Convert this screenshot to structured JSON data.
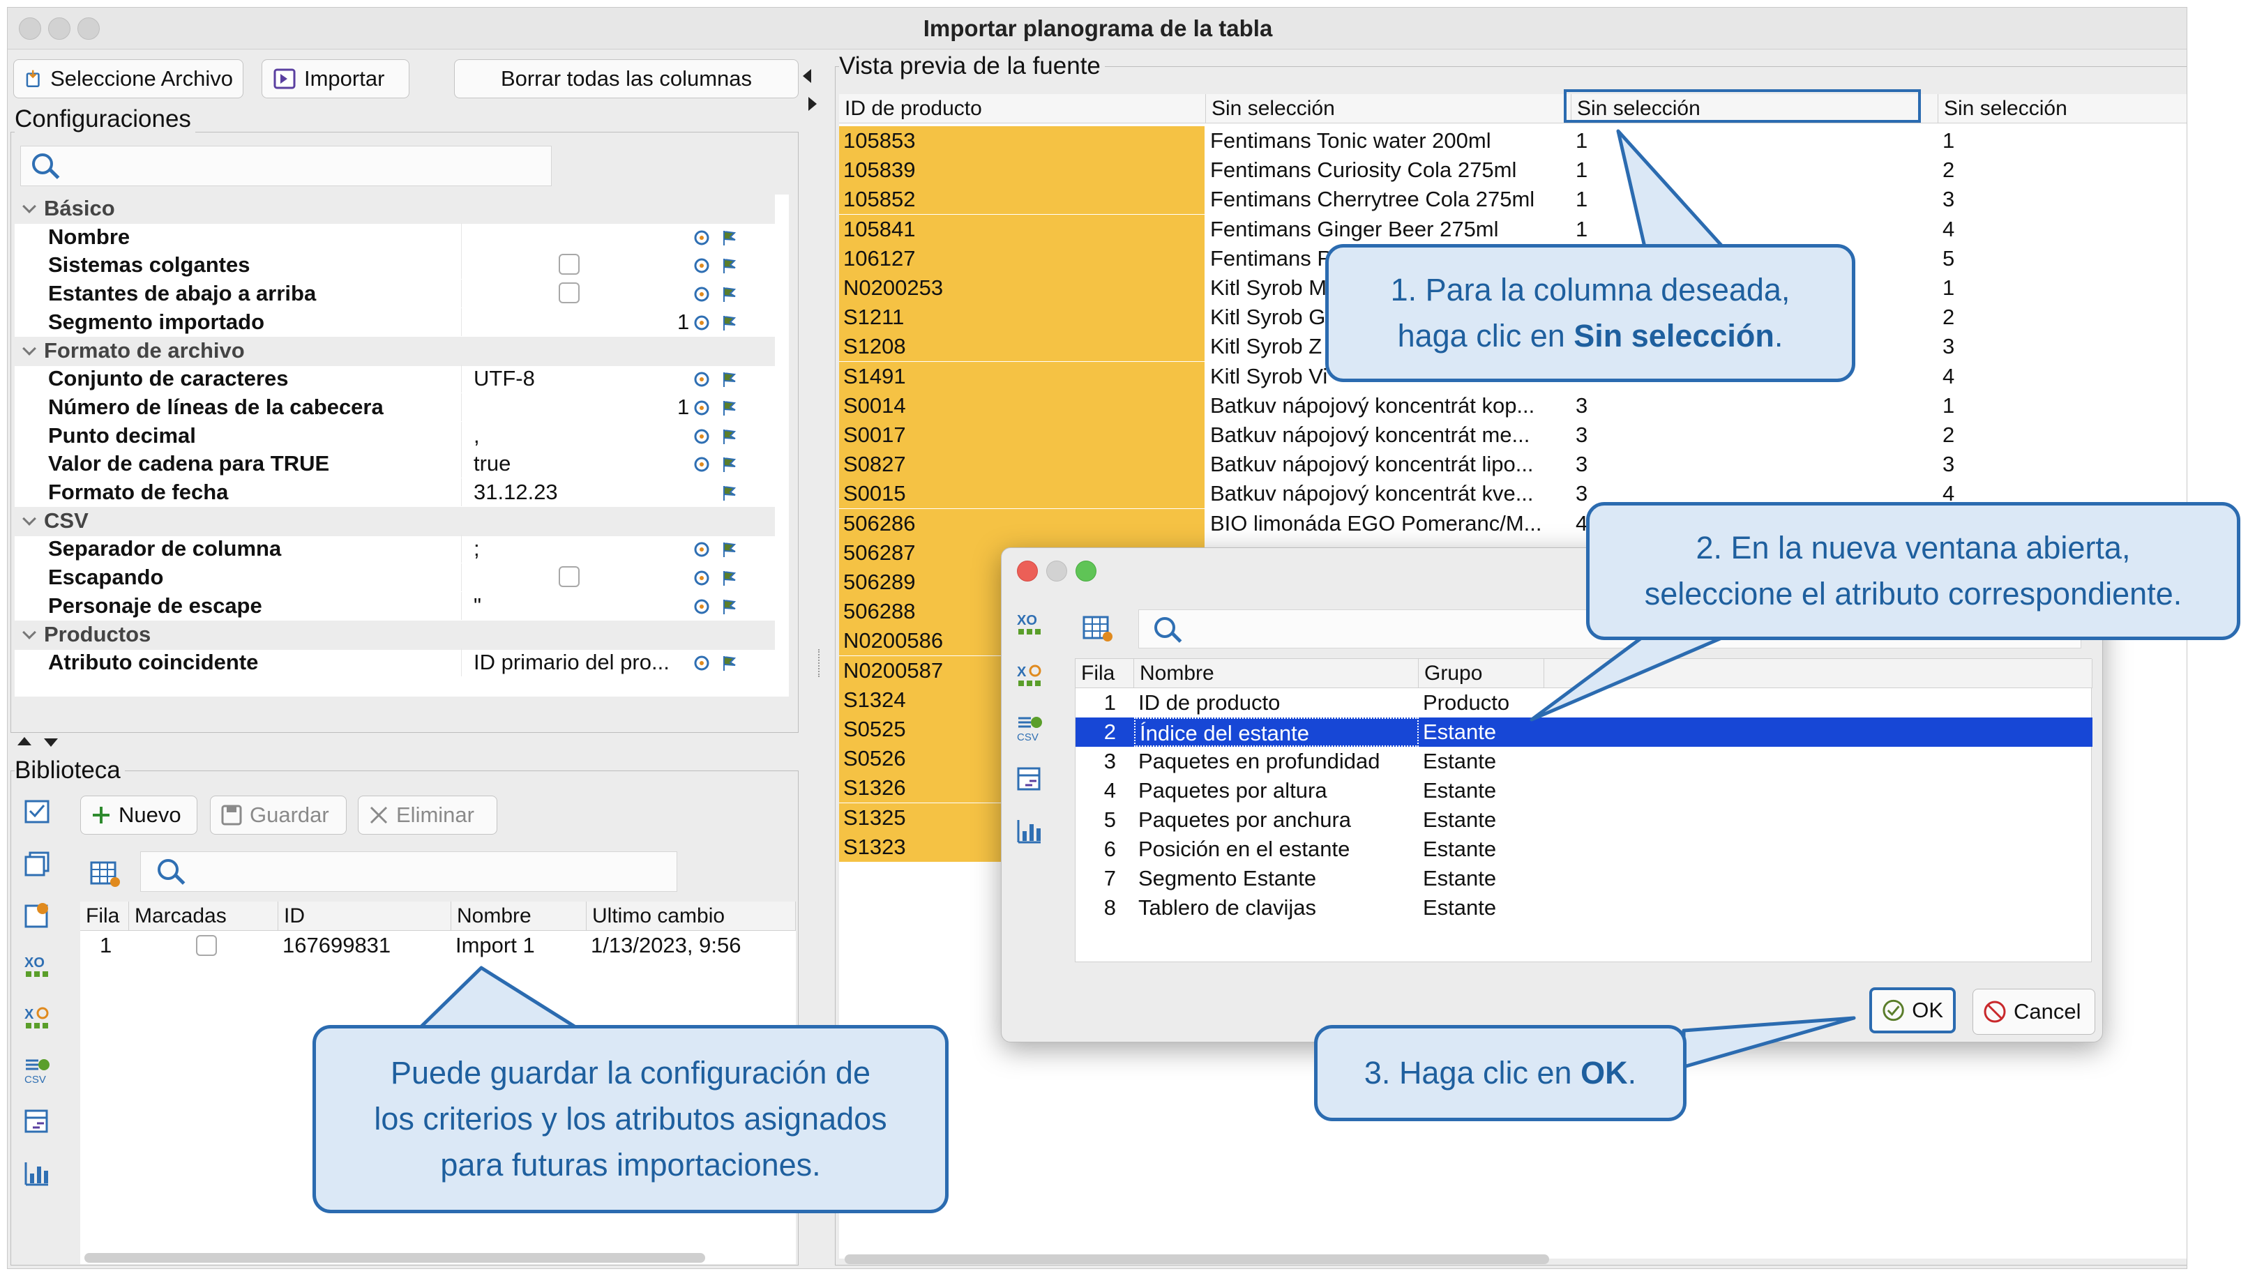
{
  "window": {
    "title": "Importar planograma de la tabla"
  },
  "toolbar": {
    "select_file": "Seleccione Archivo",
    "import": "Importar",
    "clear_columns": "Borrar todas las columnas"
  },
  "configuraciones": {
    "label": "Configuraciones",
    "search_placeholder": "",
    "rows": [
      {
        "type": "category",
        "name": "Básico"
      },
      {
        "type": "prop",
        "name": "Nombre",
        "value": "",
        "checkbox": false,
        "number": "",
        "icons": 2
      },
      {
        "type": "prop",
        "name": "Sistemas colgantes",
        "value": "",
        "checkbox": true,
        "number": "",
        "icons": 2
      },
      {
        "type": "prop",
        "name": "Estantes de abajo a arriba",
        "value": "",
        "checkbox": true,
        "number": "",
        "icons": 2
      },
      {
        "type": "prop",
        "name": "Segmento importado",
        "value": "",
        "checkbox": false,
        "number": "1",
        "icons": 2
      },
      {
        "type": "category",
        "name": "Formato de archivo"
      },
      {
        "type": "prop",
        "name": "Conjunto de caracteres",
        "value": "UTF-8",
        "checkbox": false,
        "number": "",
        "icons": 2
      },
      {
        "type": "prop",
        "name": "Número de líneas de la cabecera",
        "value": "",
        "checkbox": false,
        "number": "1",
        "icons": 2
      },
      {
        "type": "prop",
        "name": "Punto decimal",
        "value": ",",
        "checkbox": false,
        "number": "",
        "icons": 2
      },
      {
        "type": "prop",
        "name": "Valor de cadena para TRUE",
        "value": "true",
        "checkbox": false,
        "number": "",
        "icons": 2
      },
      {
        "type": "prop",
        "name": "Formato de fecha",
        "value": "31.12.23",
        "checkbox": false,
        "number": "",
        "icons": 1
      },
      {
        "type": "category",
        "name": "CSV"
      },
      {
        "type": "prop",
        "name": "Separador de columna",
        "value": ";",
        "checkbox": false,
        "number": "",
        "icons": 2
      },
      {
        "type": "prop",
        "name": "Escapando",
        "value": "",
        "checkbox": true,
        "number": "",
        "icons": 2
      },
      {
        "type": "prop",
        "name": "Personaje de escape",
        "value": "\"",
        "checkbox": false,
        "number": "",
        "icons": 2
      },
      {
        "type": "category",
        "name": "Productos"
      },
      {
        "type": "prop",
        "name": "Atributo coincidente",
        "value": "ID primario del pro...",
        "checkbox": false,
        "number": "",
        "icons": 2
      }
    ]
  },
  "biblioteca": {
    "label": "Biblioteca",
    "nuevo": "Nuevo",
    "guardar": "Guardar",
    "eliminar": "Eliminar",
    "columns": [
      "Fila",
      "Marcadas",
      "ID",
      "Nombre",
      "Ultimo cambio"
    ],
    "rows": [
      {
        "fila": "1",
        "id": "167699831",
        "nombre": "Import 1",
        "cambio": "1/13/2023, 9:56"
      }
    ]
  },
  "preview": {
    "label": "Vista previa de la fuente",
    "columns": [
      "ID de producto",
      "Sin selección",
      "Sin selección",
      "Sin selección"
    ],
    "rows": [
      [
        "105853",
        "Fentimans Tonic water 200ml",
        "1",
        "1"
      ],
      [
        "105839",
        "Fentimans Curiosity Cola 275ml",
        "1",
        "2"
      ],
      [
        "105852",
        "Fentimans Cherrytree Cola 275ml",
        "1",
        "3"
      ],
      [
        "105841",
        "Fentimans Ginger Beer 275ml",
        "1",
        "4"
      ],
      [
        "106127",
        "Fentimans R",
        "",
        "5"
      ],
      [
        "N0200253",
        "Kitl Syrob M",
        "",
        "1"
      ],
      [
        "S1211",
        "Kitl Syrob G",
        "",
        "2"
      ],
      [
        "S1208",
        "Kitl Syrob Z",
        "",
        "3"
      ],
      [
        "S1491",
        "Kitl Syrob Vi",
        "",
        "4"
      ],
      [
        "S0014",
        "Batkuv nápojový koncentrát kop...",
        "3",
        "1"
      ],
      [
        "S0017",
        "Batkuv nápojový koncentrát me...",
        "3",
        "2"
      ],
      [
        "S0827",
        "Batkuv nápojový koncentrát lipo...",
        "3",
        "3"
      ],
      [
        "S0015",
        "Batkuv nápojový koncentrát kve...",
        "3",
        "4"
      ],
      [
        "506286",
        "BIO limonáda EGO Pomeranc/M...",
        "4",
        ""
      ],
      [
        "506287",
        "",
        "",
        ""
      ],
      [
        "506289",
        "",
        "",
        ""
      ],
      [
        "506288",
        "",
        "",
        ""
      ],
      [
        "N0200586",
        "",
        "",
        ""
      ],
      [
        "N0200587",
        "",
        "",
        ""
      ],
      [
        "S1324",
        "",
        "",
        ""
      ],
      [
        "S0525",
        "",
        "",
        ""
      ],
      [
        "S0526",
        "",
        "",
        ""
      ],
      [
        "S1326",
        "",
        "",
        ""
      ],
      [
        "S1325",
        "",
        "",
        ""
      ],
      [
        "S1323",
        "",
        "",
        ""
      ]
    ]
  },
  "dialog": {
    "columns": [
      "Fila",
      "Nombre",
      "Grupo"
    ],
    "rows": [
      {
        "fila": "1",
        "nombre": "ID de producto",
        "grupo": "Producto",
        "selected": false
      },
      {
        "fila": "2",
        "nombre": "Índice del estante",
        "grupo": "Estante",
        "selected": true
      },
      {
        "fila": "3",
        "nombre": "Paquetes en profundidad",
        "grupo": "Estante",
        "selected": false
      },
      {
        "fila": "4",
        "nombre": "Paquetes por altura",
        "grupo": "Estante",
        "selected": false
      },
      {
        "fila": "5",
        "nombre": "Paquetes por anchura",
        "grupo": "Estante",
        "selected": false
      },
      {
        "fila": "6",
        "nombre": "Posición en el estante",
        "grupo": "Estante",
        "selected": false
      },
      {
        "fila": "7",
        "nombre": "Segmento Estante",
        "grupo": "Estante",
        "selected": false
      },
      {
        "fila": "8",
        "nombre": "Tablero de clavijas",
        "grupo": "Estante",
        "selected": false
      }
    ],
    "ok": "OK",
    "cancel": "Cancel"
  },
  "callouts": {
    "c1": {
      "line1": "1. Para la columna deseada,",
      "line2_pre": "haga clic en ",
      "line2_bold": "Sin selección",
      "line2_post": "."
    },
    "c2": {
      "line1": "2. En la nueva ventana abierta,",
      "line2": "seleccione el atributo correspondiente."
    },
    "c3": {
      "pre": "3. Haga clic en ",
      "bold": "OK",
      "post": "."
    },
    "c4": {
      "line1": "Puede guardar la configuración de",
      "line2": "los criterios y los atributos asignados",
      "line3": "para futuras importaciones."
    }
  },
  "colors": {
    "id_highlight": "#f5c244",
    "selection": "#1747d6",
    "callout_border": "#2b6bb0",
    "callout_fill": "#dbe8f6"
  }
}
